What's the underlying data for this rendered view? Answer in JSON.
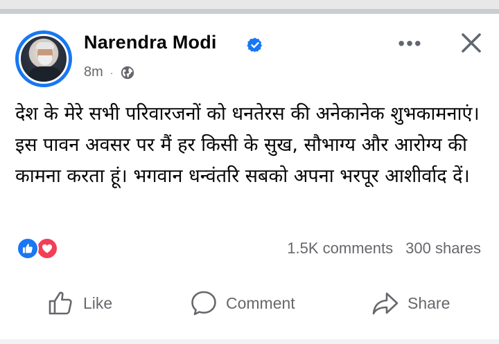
{
  "post": {
    "author": "Narendra Modi",
    "verified": true,
    "time": "8m",
    "separator": "·",
    "audience_icon": "globe-icon",
    "text": "देश के मेरे सभी परिवारजनों को धनतेरस की अनेकानेक शुभकामनाएं। इस पावन अवसर पर मैं हर किसी के सुख, सौभाग्य और आरोग्य की कामना करता हूं। भगवान धन्वंतरि सबको अपना भरपूर आशीर्वाद दें।",
    "more_icon": "•••"
  },
  "reactions": {
    "icons": [
      "like-reaction-icon",
      "love-reaction-icon"
    ],
    "comments": "1.5K comments",
    "shares": "300 shares"
  },
  "actions": {
    "like": "Like",
    "comment": "Comment",
    "share": "Share"
  },
  "colors": {
    "brand_blue": "#1877f2",
    "love_red": "#f33e58",
    "secondary_text": "#65676b",
    "primary_text": "#050505"
  }
}
